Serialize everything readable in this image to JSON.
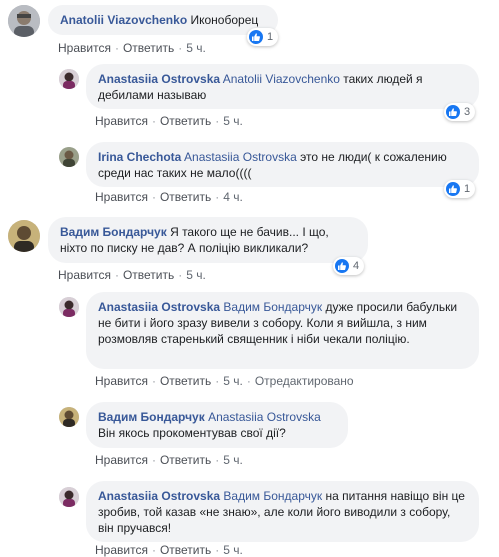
{
  "colors": {
    "link": "#385898",
    "bubble": "#f2f3f5",
    "like": "#1877f2",
    "meta": "#606770"
  },
  "comments": [
    {
      "author": "Anatolii Viazovchenko",
      "mention": "",
      "text": "Иконоборец",
      "like": "Нравится",
      "reply": "Ответить",
      "time": "5 ч.",
      "edited": "",
      "reactions": "1"
    },
    {
      "author": "Anastasiia Ostrovska",
      "mention": "Anatolii Viazovchenko",
      "text": "таких людей я дебилами называю",
      "like": "Нравится",
      "reply": "Ответить",
      "time": "5 ч.",
      "edited": "",
      "reactions": "3"
    },
    {
      "author": "Irina Chechota",
      "mention": "Anastasiia Ostrovska",
      "text": "это не люди( к сожалению среди нас таких не мало((((",
      "like": "Нравится",
      "reply": "Ответить",
      "time": "4 ч.",
      "edited": "",
      "reactions": "1"
    },
    {
      "author": "Вадим Бондарчук",
      "mention": "",
      "text": "Я такого ще не бачив... І що, ніхто по писку не дав? А поліцію викликали?",
      "like": "Нравится",
      "reply": "Ответить",
      "time": "5 ч.",
      "edited": "",
      "reactions": "4"
    },
    {
      "author": "Anastasiia Ostrovska",
      "mention": "Вадим Бондарчук",
      "text": "дуже просили бабульки не бити і його зразу вивели з собору. Коли я вийшла, з ним розмовляв старенький священник і ніби чекали поліцію.",
      "like": "Нравится",
      "reply": "Ответить",
      "time": "5 ч.",
      "edited": "Отредактировано",
      "reactions": ""
    },
    {
      "author": "Вадим Бондарчук",
      "mention": "Anastasiia Ostrovska",
      "text": "Він якось прокоментував свої дії?",
      "like": "Нравится",
      "reply": "Ответить",
      "time": "5 ч.",
      "edited": "",
      "reactions": ""
    },
    {
      "author": "Anastasiia Ostrovska",
      "mention": "Вадим Бондарчук",
      "text": "на питання навіщо він це зробив, той казав «не знаю», але коли його виводили з собору, він пручався!",
      "like": "Нравится",
      "reply": "Ответить",
      "time": "5 ч.",
      "edited": "",
      "reactions": ""
    }
  ]
}
